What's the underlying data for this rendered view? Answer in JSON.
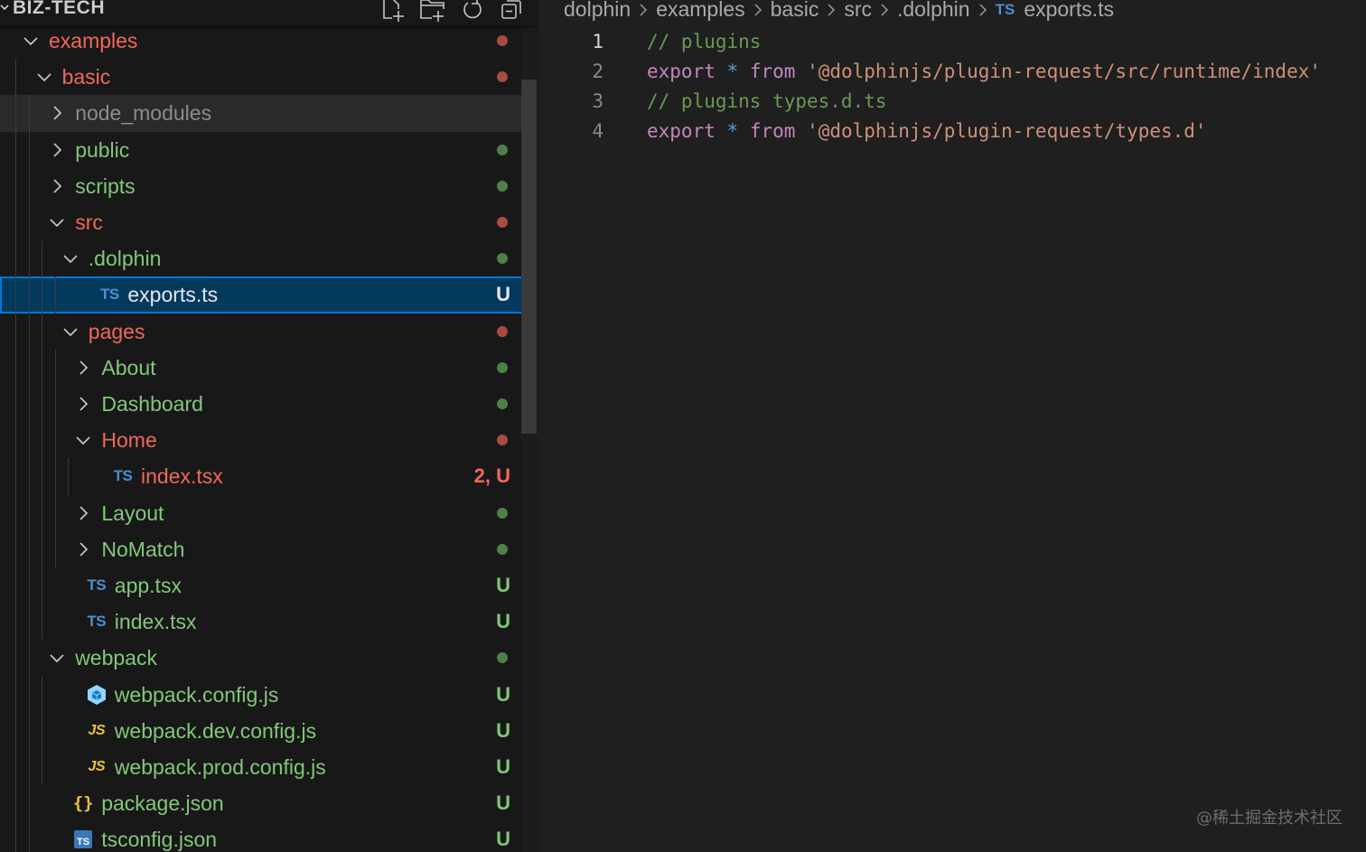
{
  "explorer": {
    "root_title": "BIZ-TECH",
    "actions": [
      {
        "icon": "new-file-icon"
      },
      {
        "icon": "new-folder-icon"
      },
      {
        "icon": "refresh-icon"
      },
      {
        "icon": "collapse-all-icon"
      }
    ],
    "items": [
      {
        "label": "examples",
        "kind": "folder",
        "expanded": true,
        "status": "",
        "status_color": "#a84b43",
        "label_color": "#f0685b"
      },
      {
        "label": "basic",
        "kind": "folder",
        "expanded": true,
        "status": "",
        "status_color": "#a84b43",
        "label_color": "#f0685b"
      },
      {
        "label": "node_modules",
        "kind": "folder",
        "expanded": false,
        "status": "",
        "label_color": "#8c8c8c"
      },
      {
        "label": "public",
        "kind": "folder",
        "expanded": false,
        "status": "",
        "status_color": "#4f7f4a",
        "label_color": "#82c879"
      },
      {
        "label": "scripts",
        "kind": "folder",
        "expanded": false,
        "status": "",
        "status_color": "#4f7f4a",
        "label_color": "#82c879"
      },
      {
        "label": "src",
        "kind": "folder",
        "expanded": true,
        "status": "",
        "status_color": "#a84b43",
        "label_color": "#f0685b"
      },
      {
        "label": ".dolphin",
        "kind": "folder",
        "expanded": true,
        "status": "",
        "status_color": "#4f7f4a",
        "label_color": "#82c879"
      },
      {
        "label": "exports.ts",
        "kind": "file",
        "icon": "TS",
        "status": "U",
        "label_color": "#e8e8e8",
        "selected": true
      },
      {
        "label": "pages",
        "kind": "folder",
        "expanded": true,
        "status": "",
        "status_color": "#a84b43",
        "label_color": "#f0685b"
      },
      {
        "label": "About",
        "kind": "folder",
        "expanded": false,
        "status": "",
        "status_color": "#4f7f4a",
        "label_color": "#82c879"
      },
      {
        "label": "Dashboard",
        "kind": "folder",
        "expanded": false,
        "status": "",
        "status_color": "#4f7f4a",
        "label_color": "#82c879"
      },
      {
        "label": "Home",
        "kind": "folder",
        "expanded": true,
        "status": "",
        "status_color": "#a84b43",
        "label_color": "#f0685b"
      },
      {
        "label": "index.tsx",
        "kind": "file",
        "icon": "TS",
        "status": "2, U",
        "label_color": "#f0685b"
      },
      {
        "label": "Layout",
        "kind": "folder",
        "expanded": false,
        "status": "",
        "status_color": "#4f7f4a",
        "label_color": "#82c879"
      },
      {
        "label": "NoMatch",
        "kind": "folder",
        "expanded": false,
        "status": "",
        "status_color": "#4f7f4a",
        "label_color": "#82c879"
      },
      {
        "label": "app.tsx",
        "kind": "file",
        "icon": "TS",
        "status": "U",
        "label_color": "#82c879"
      },
      {
        "label": "index.tsx",
        "kind": "file",
        "icon": "TS",
        "status": "U",
        "label_color": "#82c879"
      },
      {
        "label": "webpack",
        "kind": "folder",
        "expanded": true,
        "status": "",
        "status_color": "#4f7f4a",
        "label_color": "#82c879"
      },
      {
        "label": "webpack.config.js",
        "kind": "file",
        "icon": "webpack-cube",
        "status": "U",
        "label_color": "#82c879"
      },
      {
        "label": "webpack.dev.config.js",
        "kind": "file",
        "icon": "JS",
        "status": "U",
        "label_color": "#82c879"
      },
      {
        "label": "webpack.prod.config.js",
        "kind": "file",
        "icon": "JS",
        "status": "U",
        "label_color": "#82c879"
      },
      {
        "label": "package.json",
        "kind": "file",
        "icon": "{}",
        "status": "U",
        "label_color": "#82c879"
      },
      {
        "label": "tsconfig.json",
        "kind": "file",
        "icon": "TS",
        "status": "U",
        "label_color": "#82c879"
      }
    ]
  },
  "editor": {
    "breadcrumb": [
      "dolphin",
      "examples",
      "basic",
      "src",
      ".dolphin"
    ],
    "breadcrumb_file_icon": "TS",
    "breadcrumb_file": "exports.ts",
    "lines": [
      {
        "number": "1",
        "tokens": [
          {
            "t": "comment",
            "v": "// plugins"
          }
        ]
      },
      {
        "number": "2",
        "tokens": [
          {
            "t": "keyword",
            "v": "export"
          },
          {
            "t": "space",
            "v": " "
          },
          {
            "t": "op",
            "v": "*"
          },
          {
            "t": "space",
            "v": " "
          },
          {
            "t": "keyword",
            "v": "from"
          },
          {
            "t": "space",
            "v": " "
          },
          {
            "t": "string",
            "v": "'@dolphinjs/plugin-request/src/runtime/index'"
          }
        ]
      },
      {
        "number": "3",
        "tokens": [
          {
            "t": "comment",
            "v": "// plugins types.d.ts"
          }
        ]
      },
      {
        "number": "4",
        "tokens": [
          {
            "t": "keyword",
            "v": "export"
          },
          {
            "t": "space",
            "v": " "
          },
          {
            "t": "op",
            "v": "*"
          },
          {
            "t": "space",
            "v": " "
          },
          {
            "t": "keyword",
            "v": "from"
          },
          {
            "t": "space",
            "v": " "
          },
          {
            "t": "string",
            "v": "'@dolphinjs/plugin-request/types.d'"
          }
        ]
      }
    ]
  },
  "watermark": "@稀土掘金技术社区"
}
